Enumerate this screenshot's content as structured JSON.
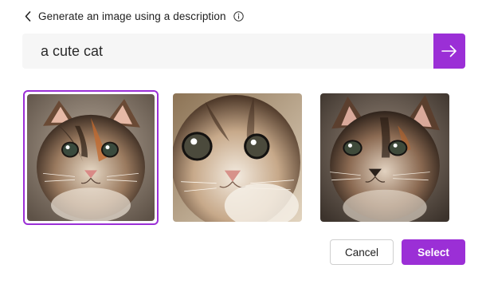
{
  "header": {
    "back_icon": "chevron-left-icon",
    "title": "Generate an image using a description",
    "info_icon": "info-icon"
  },
  "prompt": {
    "value": "a cute cat",
    "submit_icon": "arrow-right-icon"
  },
  "images": [
    {
      "label": "kitten-1",
      "selected": true
    },
    {
      "label": "kitten-2",
      "selected": false
    },
    {
      "label": "kitten-3",
      "selected": false
    }
  ],
  "buttons": {
    "cancel": "Cancel",
    "select": "Select"
  },
  "colors": {
    "accent": "#9b2fd6",
    "input_bg": "#f6f6f6"
  }
}
